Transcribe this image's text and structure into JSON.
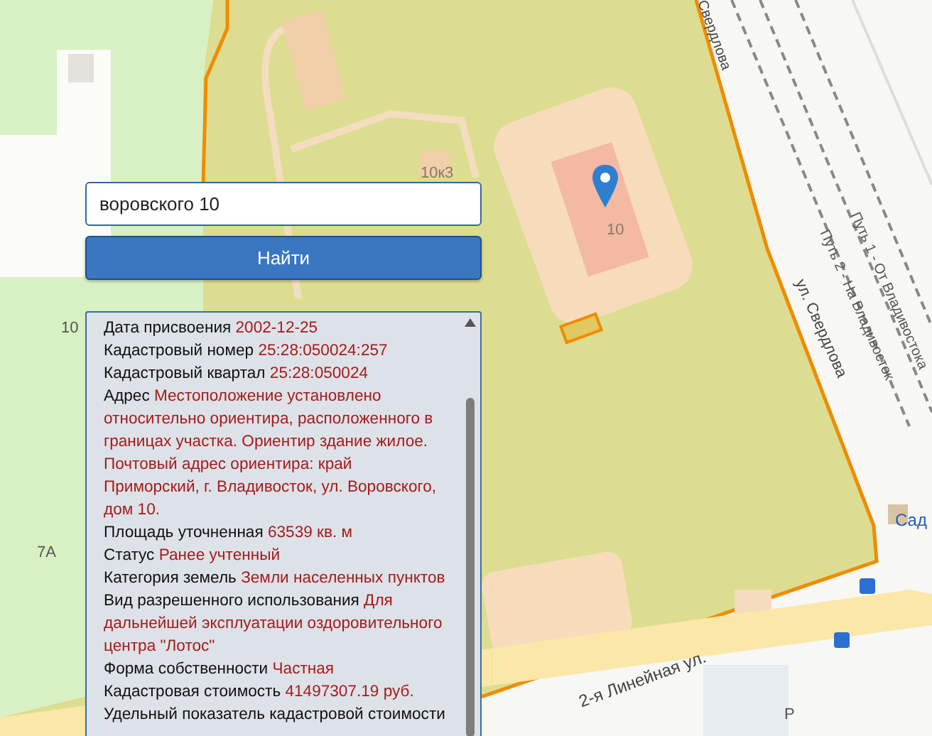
{
  "map": {
    "labels": [
      {
        "text": "10к3",
        "kind": "house"
      },
      {
        "text": "10",
        "kind": "house-main"
      },
      {
        "text": "10",
        "kind": "house-left"
      },
      {
        "text": "7А",
        "kind": "house-lower"
      },
      {
        "text": "Свердлова",
        "kind": "street-top"
      },
      {
        "text": "ул. Свердлова",
        "kind": "street-mid"
      },
      {
        "text": "Путь 1 - От Владивостока",
        "kind": "rail-1"
      },
      {
        "text": "Путь 2 - На Владивосток",
        "kind": "rail-2"
      },
      {
        "text": "2-я Линейная ул.",
        "kind": "street-bottom"
      },
      {
        "text": "Сад",
        "kind": "stop"
      },
      {
        "text": "P",
        "kind": "parking"
      }
    ]
  },
  "search": {
    "value": "воровского 10"
  },
  "find_button": "Найти",
  "info": {
    "fields": [
      {
        "label": "Дата присвоения",
        "value": "2002-12-25"
      },
      {
        "label": "Кадастровый номер",
        "value": "25:28:050024:257"
      },
      {
        "label": "Кадастровый квартал",
        "value": "25:28:050024"
      },
      {
        "label": "Адрес",
        "value": "Местоположение установлено относительно ориентира, расположенного в границах участка. Ориентир здание жилое. Почтовый адрес ориентира: край Приморский, г. Владивосток, ул. Воровского, дом 10."
      },
      {
        "label": "Площадь уточненная",
        "value": "63539 кв. м"
      },
      {
        "label": "Статус",
        "value": "Ранее учтенный"
      },
      {
        "label": "Категория земель",
        "value": "Земли населенных пунктов"
      },
      {
        "label": "Вид разрешенного использования",
        "value": "Для дальнейшей эксплуатации оздоровительного центра \"Лотос\""
      },
      {
        "label": "Форма собственности",
        "value": "Частная"
      },
      {
        "label": "Кадастровая стоимость",
        "value": "41497307.19 руб."
      },
      {
        "label": "Удельный показатель кадастровой стоимости"
      }
    ]
  }
}
